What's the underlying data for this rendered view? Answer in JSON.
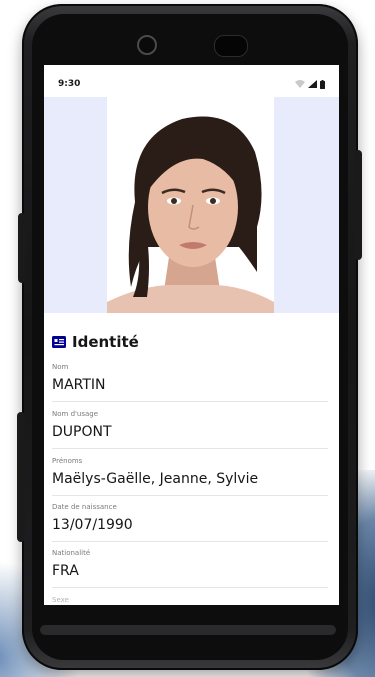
{
  "status_bar": {
    "time": "9:30",
    "icons": [
      "wifi-icon",
      "signal-icon",
      "battery-icon"
    ]
  },
  "colors": {
    "accent": "#000091",
    "photo_background": "#e8ebfb",
    "text": "#161616",
    "label": "#7b7b7b"
  },
  "identity": {
    "section_icon": "id-card-icon",
    "section_title": "Identité",
    "fields": [
      {
        "label": "Nom",
        "value": "MARTIN"
      },
      {
        "label": "Nom d'usage",
        "value": "DUPONT"
      },
      {
        "label": "Prénoms",
        "value": "Maëlys-Gaëlle, Jeanne, Sylvie"
      },
      {
        "label": "Date de naissance",
        "value": "13/07/1990"
      },
      {
        "label": "Nationalité",
        "value": "FRA"
      },
      {
        "label": "Sexe",
        "value": ""
      }
    ]
  }
}
